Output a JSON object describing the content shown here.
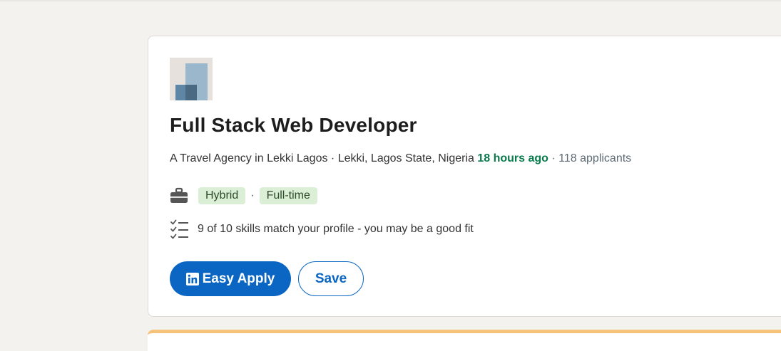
{
  "job": {
    "title": "Full Stack Web Developer",
    "company_location": "A Travel Agency in Lekki Lagos · Lekki, Lagos State, Nigeria",
    "posted": "18 hours ago",
    "applicants": "· 118 applicants",
    "workplace_type": "Hybrid",
    "separator": "·",
    "employment_type": "Full-time",
    "skills_match": "9 of 10 skills match your profile - you may be a good fit"
  },
  "actions": {
    "apply_label": "Easy Apply",
    "save_label": "Save"
  },
  "colors": {
    "primary": "#0a66c2",
    "posted_green": "#0a7a4d",
    "tag_bg": "#daefd6",
    "page_bg": "#f4f2ee"
  },
  "icons": {
    "company_logo": "company-logo",
    "workplace": "briefcase-icon",
    "skills": "checklist-icon",
    "apply": "linkedin-icon"
  }
}
